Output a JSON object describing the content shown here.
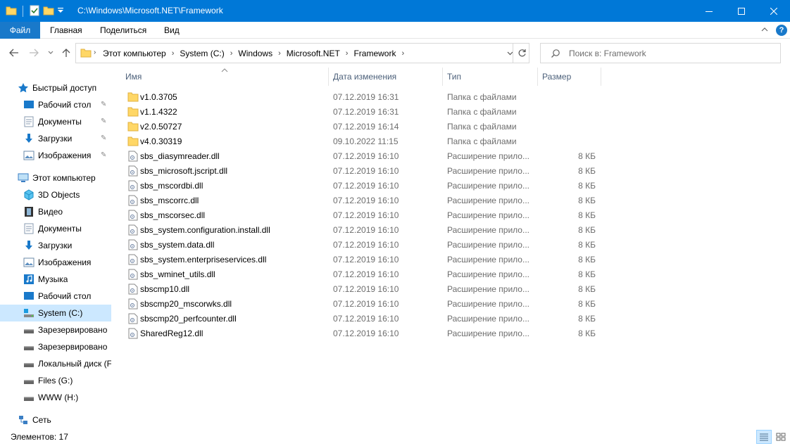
{
  "window": {
    "title": "C:\\Windows\\Microsoft.NET\\Framework"
  },
  "ribbon": {
    "tabs": [
      "Файл",
      "Главная",
      "Поделиться",
      "Вид"
    ],
    "help": "?"
  },
  "address": {
    "crumbs": [
      "Этот компьютер",
      "System (C:)",
      "Windows",
      "Microsoft.NET",
      "Framework"
    ]
  },
  "search": {
    "placeholder": "Поиск в: Framework"
  },
  "nav": {
    "quick_access": "Быстрый доступ",
    "quick_items": [
      "Рабочий стол",
      "Документы",
      "Загрузки",
      "Изображения"
    ],
    "this_pc": "Этот компьютер",
    "pc_items": [
      "3D Objects",
      "Видео",
      "Документы",
      "Загрузки",
      "Изображения",
      "Музыка",
      "Рабочий стол",
      "System (C:)",
      "Зарезервировано",
      "Зарезервировано",
      "Локальный диск (F",
      "Files (G:)",
      "WWW (H:)"
    ],
    "network": "Сеть"
  },
  "columns": {
    "name": "Имя",
    "date": "Дата изменения",
    "type": "Тип",
    "size": "Размер"
  },
  "files": [
    {
      "name": "v1.0.3705",
      "date": "07.12.2019 16:31",
      "type": "Папка с файлами",
      "size": "",
      "kind": "folder"
    },
    {
      "name": "v1.1.4322",
      "date": "07.12.2019 16:31",
      "type": "Папка с файлами",
      "size": "",
      "kind": "folder"
    },
    {
      "name": "v2.0.50727",
      "date": "07.12.2019 16:14",
      "type": "Папка с файлами",
      "size": "",
      "kind": "folder"
    },
    {
      "name": "v4.0.30319",
      "date": "09.10.2022 11:15",
      "type": "Папка с файлами",
      "size": "",
      "kind": "folder"
    },
    {
      "name": "sbs_diasymreader.dll",
      "date": "07.12.2019 16:10",
      "type": "Расширение прило...",
      "size": "8 КБ",
      "kind": "dll"
    },
    {
      "name": "sbs_microsoft.jscript.dll",
      "date": "07.12.2019 16:10",
      "type": "Расширение прило...",
      "size": "8 КБ",
      "kind": "dll"
    },
    {
      "name": "sbs_mscordbi.dll",
      "date": "07.12.2019 16:10",
      "type": "Расширение прило...",
      "size": "8 КБ",
      "kind": "dll"
    },
    {
      "name": "sbs_mscorrc.dll",
      "date": "07.12.2019 16:10",
      "type": "Расширение прило...",
      "size": "8 КБ",
      "kind": "dll"
    },
    {
      "name": "sbs_mscorsec.dll",
      "date": "07.12.2019 16:10",
      "type": "Расширение прило...",
      "size": "8 КБ",
      "kind": "dll"
    },
    {
      "name": "sbs_system.configuration.install.dll",
      "date": "07.12.2019 16:10",
      "type": "Расширение прило...",
      "size": "8 КБ",
      "kind": "dll"
    },
    {
      "name": "sbs_system.data.dll",
      "date": "07.12.2019 16:10",
      "type": "Расширение прило...",
      "size": "8 КБ",
      "kind": "dll"
    },
    {
      "name": "sbs_system.enterpriseservices.dll",
      "date": "07.12.2019 16:10",
      "type": "Расширение прило...",
      "size": "8 КБ",
      "kind": "dll"
    },
    {
      "name": "sbs_wminet_utils.dll",
      "date": "07.12.2019 16:10",
      "type": "Расширение прило...",
      "size": "8 КБ",
      "kind": "dll"
    },
    {
      "name": "sbscmp10.dll",
      "date": "07.12.2019 16:10",
      "type": "Расширение прило...",
      "size": "8 КБ",
      "kind": "dll"
    },
    {
      "name": "sbscmp20_mscorwks.dll",
      "date": "07.12.2019 16:10",
      "type": "Расширение прило...",
      "size": "8 КБ",
      "kind": "dll"
    },
    {
      "name": "sbscmp20_perfcounter.dll",
      "date": "07.12.2019 16:10",
      "type": "Расширение прило...",
      "size": "8 КБ",
      "kind": "dll"
    },
    {
      "name": "SharedReg12.dll",
      "date": "07.12.2019 16:10",
      "type": "Расширение прило...",
      "size": "8 КБ",
      "kind": "dll"
    }
  ],
  "status": {
    "items_count": "Элементов: 17"
  },
  "colors": {
    "accent": "#0078d7",
    "selection": "#cce8ff",
    "folder": "#ffd766"
  }
}
